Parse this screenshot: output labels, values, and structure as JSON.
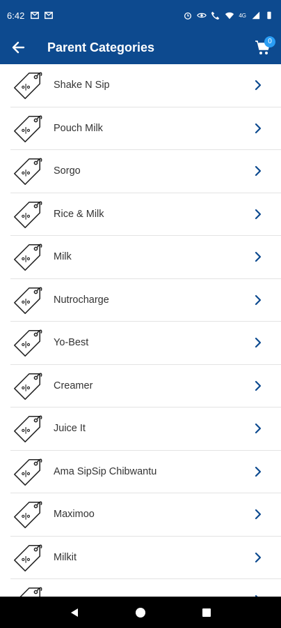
{
  "status": {
    "time": "6:42",
    "battery_label": "4G"
  },
  "app_bar": {
    "title": "Parent Categories",
    "cart_count": "0"
  },
  "categories": [
    {
      "label": "Shake N Sip"
    },
    {
      "label": "Pouch Milk"
    },
    {
      "label": "Sorgo"
    },
    {
      "label": "Rice & Milk"
    },
    {
      "label": "Milk"
    },
    {
      "label": "Nutrocharge"
    },
    {
      "label": "Yo-Best"
    },
    {
      "label": "Creamer"
    },
    {
      "label": "Juice It"
    },
    {
      "label": "Ama SipSip Chibwantu"
    },
    {
      "label": "Maximoo"
    },
    {
      "label": "Milkit"
    },
    {
      "label": ""
    }
  ],
  "colors": {
    "primary": "#0d4a8f",
    "chevron": "#0d4a8f",
    "badge": "#2a9df4"
  },
  "icons": {
    "back": "arrow-left-icon",
    "cart": "shopping-cart-icon",
    "item": "price-tag-icon",
    "chevron": "chevron-right-icon"
  }
}
